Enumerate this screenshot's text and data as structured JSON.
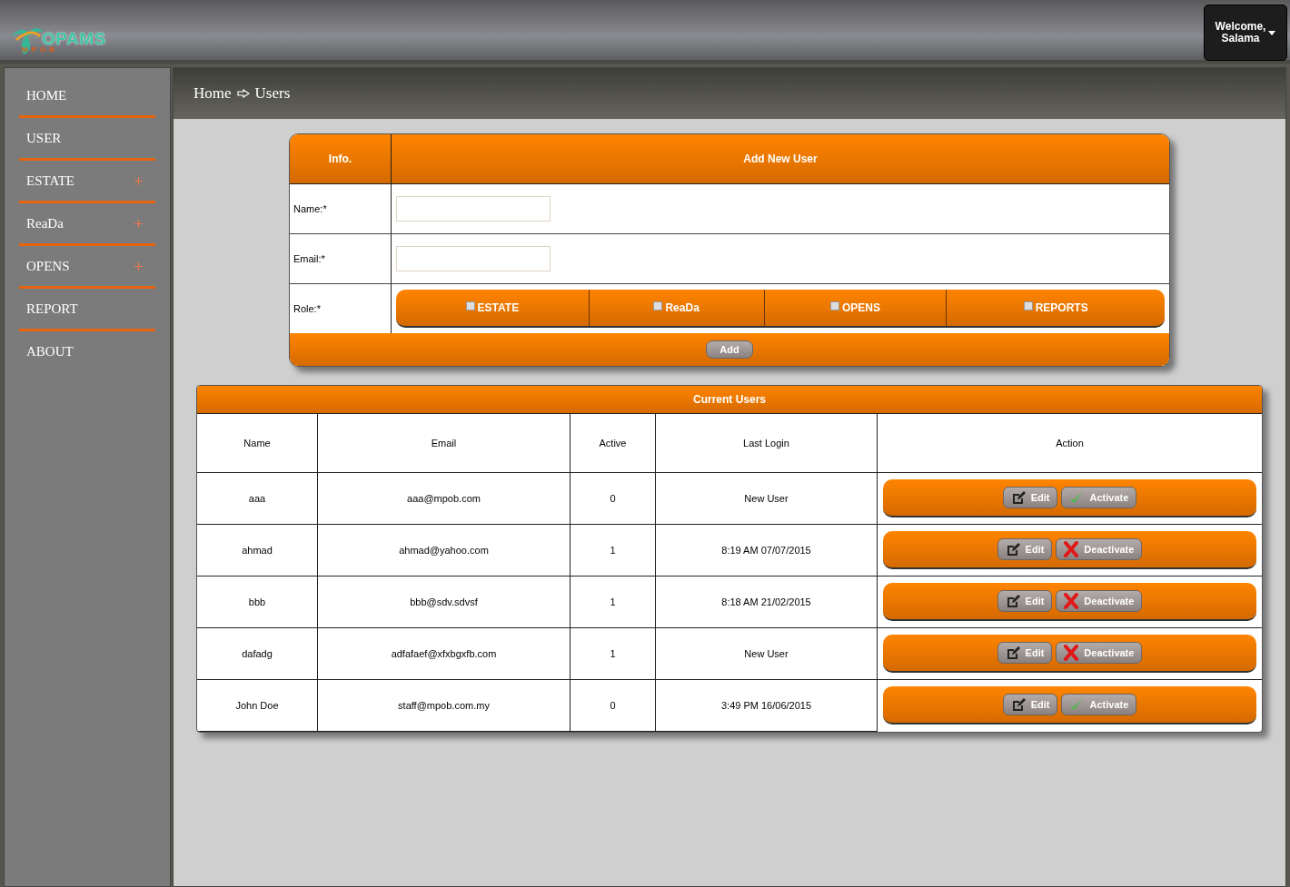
{
  "header": {
    "logo_text": "OPAMS",
    "logo_subtext": "MPOB",
    "welcome": "Welcome,",
    "user": "Salama"
  },
  "sidebar": {
    "items": [
      {
        "label": "HOME",
        "expandable": false
      },
      {
        "label": "USER",
        "expandable": false
      },
      {
        "label": "ESTATE",
        "expandable": true
      },
      {
        "label": "ReaDa",
        "expandable": true
      },
      {
        "label": "OPENS",
        "expandable": true
      },
      {
        "label": "REPORT",
        "expandable": false
      },
      {
        "label": "ABOUT",
        "expandable": false
      }
    ]
  },
  "breadcrumb": {
    "items": [
      "Home",
      "Users"
    ]
  },
  "add_user_form": {
    "info_heading": "Info.",
    "title": "Add New User",
    "fields": [
      {
        "label": "Name:*"
      },
      {
        "label": "Email:*"
      }
    ],
    "role_label": "Role:*",
    "roles": [
      {
        "label": "ESTATE",
        "checked": false
      },
      {
        "label": "ReaDa",
        "checked": false
      },
      {
        "label": "OPENS",
        "checked": false
      },
      {
        "label": "REPORTS",
        "checked": false
      }
    ],
    "add_button": "Add"
  },
  "users_table": {
    "title": "Current Users",
    "columns": [
      "Name",
      "Email",
      "Active",
      "Last Login",
      "Action"
    ],
    "rows": [
      {
        "name": "aaa",
        "email": "aaa@mpob.com",
        "active": "0",
        "last_login": "New User",
        "edit": "Edit",
        "action": {
          "kind": "activate",
          "label": "Activate"
        }
      },
      {
        "name": "ahmad",
        "email": "ahmad@yahoo.com",
        "active": "1",
        "last_login": "8:19 AM 07/07/2015",
        "edit": "Edit",
        "action": {
          "kind": "deactivate",
          "label": "Deactivate"
        }
      },
      {
        "name": "bbb",
        "email": "bbb@sdv.sdvsf",
        "active": "1",
        "last_login": "8:18 AM 21/02/2015",
        "edit": "Edit",
        "action": {
          "kind": "deactivate",
          "label": "Deactivate"
        }
      },
      {
        "name": "dafadg",
        "email": "adfafaef@xfxbgxfb.com",
        "active": "1",
        "last_login": "New User",
        "edit": "Edit",
        "action": {
          "kind": "deactivate",
          "label": "Deactivate"
        }
      },
      {
        "name": "John Doe",
        "email": "staff@mpob.com.my",
        "active": "0",
        "last_login": "3:49 PM 16/06/2015",
        "edit": "Edit",
        "action": {
          "kind": "activate",
          "label": "Activate"
        }
      }
    ]
  }
}
